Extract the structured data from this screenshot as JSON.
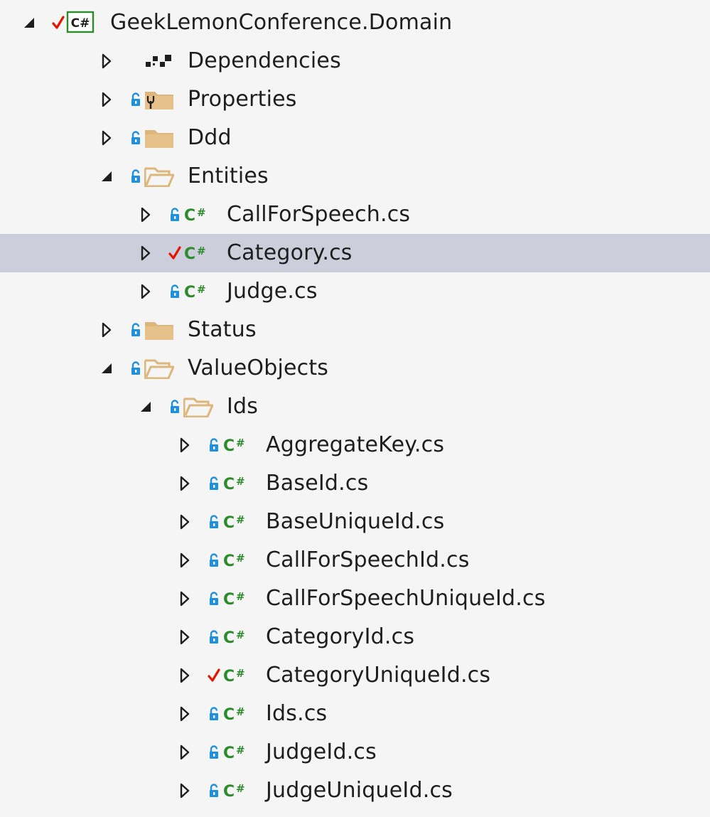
{
  "colors": {
    "background": "#f5f5f5",
    "selected_row": "#cccedb",
    "folder": "#dcb67a",
    "lock_blue": "#1e90e0",
    "check_red": "#e51400",
    "csharp_green": "#2c8c2c"
  },
  "solution_explorer": {
    "items": [
      {
        "label": "GeekLemonConference.Domain",
        "depth": 0,
        "expander": "expanded",
        "status": "check",
        "icon": "csharp-project-icon",
        "selected": false
      },
      {
        "label": "Dependencies",
        "depth": 1,
        "expander": "collapsed",
        "status": "none",
        "icon": "dependencies-icon",
        "selected": false
      },
      {
        "label": "Properties",
        "depth": 1,
        "expander": "collapsed",
        "status": "lock",
        "icon": "properties-folder-icon",
        "selected": false
      },
      {
        "label": "Ddd",
        "depth": 1,
        "expander": "collapsed",
        "status": "lock",
        "icon": "folder-icon",
        "selected": false
      },
      {
        "label": "Entities",
        "depth": 1,
        "expander": "expanded",
        "status": "lock",
        "icon": "folder-open-icon",
        "selected": false
      },
      {
        "label": "CallForSpeech.cs",
        "depth": 2,
        "expander": "collapsed",
        "status": "lock",
        "icon": "csharp-file-icon",
        "selected": false
      },
      {
        "label": "Category.cs",
        "depth": 2,
        "expander": "collapsed",
        "status": "check",
        "icon": "csharp-file-icon",
        "selected": true
      },
      {
        "label": "Judge.cs",
        "depth": 2,
        "expander": "collapsed",
        "status": "lock",
        "icon": "csharp-file-icon",
        "selected": false
      },
      {
        "label": "Status",
        "depth": 1,
        "expander": "collapsed",
        "status": "lock",
        "icon": "folder-icon",
        "selected": false
      },
      {
        "label": "ValueObjects",
        "depth": 1,
        "expander": "expanded",
        "status": "lock",
        "icon": "folder-open-icon",
        "selected": false
      },
      {
        "label": "Ids",
        "depth": 2,
        "expander": "expanded",
        "status": "lock",
        "icon": "folder-open-icon",
        "selected": false
      },
      {
        "label": "AggregateKey.cs",
        "depth": 3,
        "expander": "collapsed",
        "status": "lock",
        "icon": "csharp-file-icon",
        "selected": false
      },
      {
        "label": "BaseId.cs",
        "depth": 3,
        "expander": "collapsed",
        "status": "lock",
        "icon": "csharp-file-icon",
        "selected": false
      },
      {
        "label": "BaseUniqueId.cs",
        "depth": 3,
        "expander": "collapsed",
        "status": "lock",
        "icon": "csharp-file-icon",
        "selected": false
      },
      {
        "label": "CallForSpeechId.cs",
        "depth": 3,
        "expander": "collapsed",
        "status": "lock",
        "icon": "csharp-file-icon",
        "selected": false
      },
      {
        "label": "CallForSpeechUniqueId.cs",
        "depth": 3,
        "expander": "collapsed",
        "status": "lock",
        "icon": "csharp-file-icon",
        "selected": false
      },
      {
        "label": "CategoryId.cs",
        "depth": 3,
        "expander": "collapsed",
        "status": "lock",
        "icon": "csharp-file-icon",
        "selected": false
      },
      {
        "label": "CategoryUniqueId.cs",
        "depth": 3,
        "expander": "collapsed",
        "status": "check",
        "icon": "csharp-file-icon",
        "selected": false
      },
      {
        "label": "Ids.cs",
        "depth": 3,
        "expander": "collapsed",
        "status": "lock",
        "icon": "csharp-file-icon",
        "selected": false
      },
      {
        "label": "JudgeId.cs",
        "depth": 3,
        "expander": "collapsed",
        "status": "lock",
        "icon": "csharp-file-icon",
        "selected": false
      },
      {
        "label": "JudgeUniqueId.cs",
        "depth": 3,
        "expander": "collapsed",
        "status": "lock",
        "icon": "csharp-file-icon",
        "selected": false
      }
    ]
  }
}
